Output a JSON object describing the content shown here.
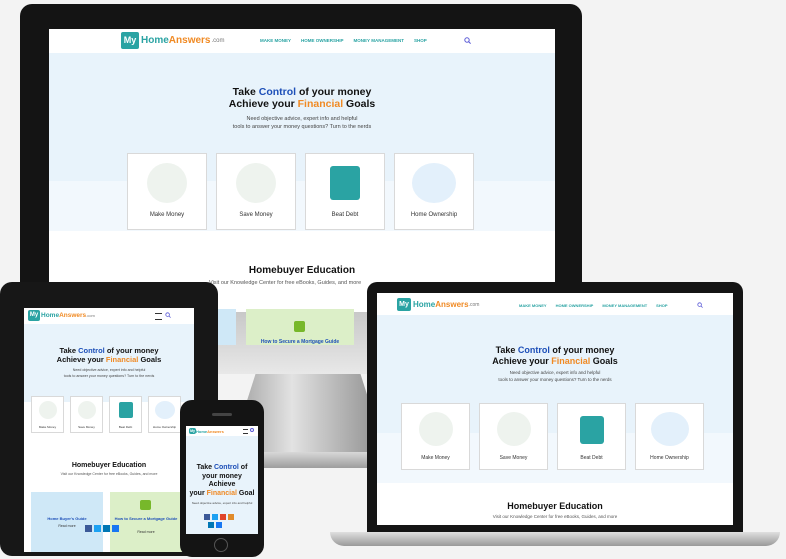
{
  "site": {
    "logo_my": "My",
    "logo_home": "Home",
    "logo_answers": "Answers",
    "logo_com": ".com",
    "nav": [
      "MAKE MONEY",
      "HOME OWNERSHIP",
      "MONEY MANAGEMENT",
      "SHOP"
    ],
    "hero_title_1a": "Take ",
    "hero_title_1b": "Control",
    "hero_title_1c": " of your money",
    "hero_title_2a": "Achieve your ",
    "hero_title_2b": "Financial",
    "hero_title_2c": " Goals",
    "hero_sub_1": "Need objective advice, expert info and helpful",
    "hero_sub_2": "tools to answer your money questions? Turn to the nerds",
    "cards": [
      "Make Money",
      "Save Money",
      "Beat Debt",
      "Home Ownership"
    ],
    "section_title": "Homebuyer Education",
    "section_sub": "Visit our Knowledge Center for free eBooks, Guides, and more",
    "guide_1": "Home Buyer's Guide",
    "guide_2": "How to Secure a Mortgage Guide",
    "read_more": "Read more"
  },
  "phone_hero": {
    "l1a": "Take ",
    "l1b": "Control",
    "l1c": " of",
    "l2": "your money",
    "l3": "Achieve",
    "l4a": "your ",
    "l4b": "Financial",
    "l4c": " Goal"
  },
  "colors": {
    "teal": "#2aa3a3",
    "orange": "#f08a24",
    "blue": "#1d4fb8",
    "hero_bg": "#e8f3fb"
  }
}
